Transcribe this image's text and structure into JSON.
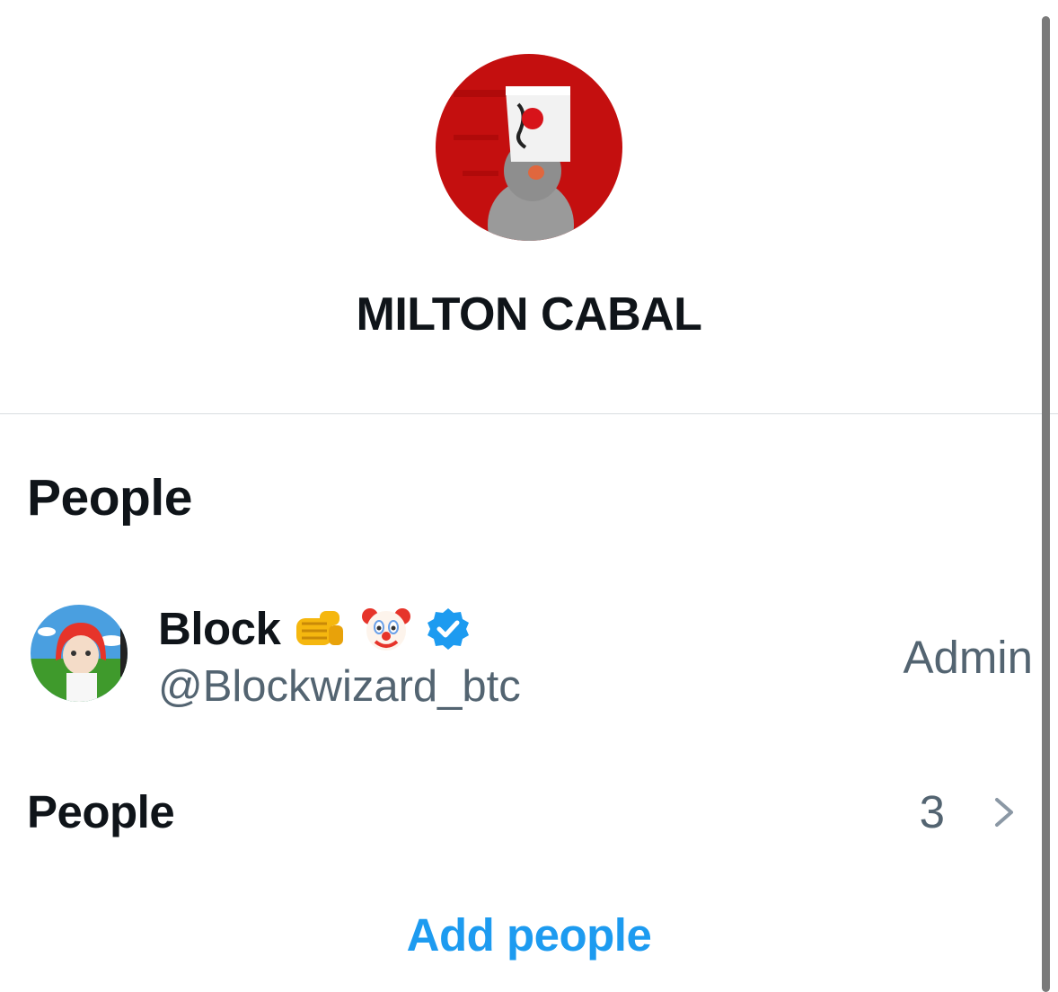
{
  "group": {
    "name": "MILTON CABAL",
    "avatar_icon": "pigeon-bucket-avatar"
  },
  "people_section": {
    "heading": "People",
    "members": [
      {
        "name": "Block",
        "emojis": [
          "punch-emoji",
          "clown-emoji"
        ],
        "verified": true,
        "handle": "@Blockwizard_btc",
        "role": "Admin"
      }
    ],
    "people_row": {
      "label": "People",
      "count": "3",
      "chevron_icon": "chevron-right-icon"
    },
    "add_people_label": "Add people"
  },
  "colors": {
    "accent": "#1d9bf0",
    "secondary_text": "#536471",
    "primary_text": "#0f1419"
  }
}
